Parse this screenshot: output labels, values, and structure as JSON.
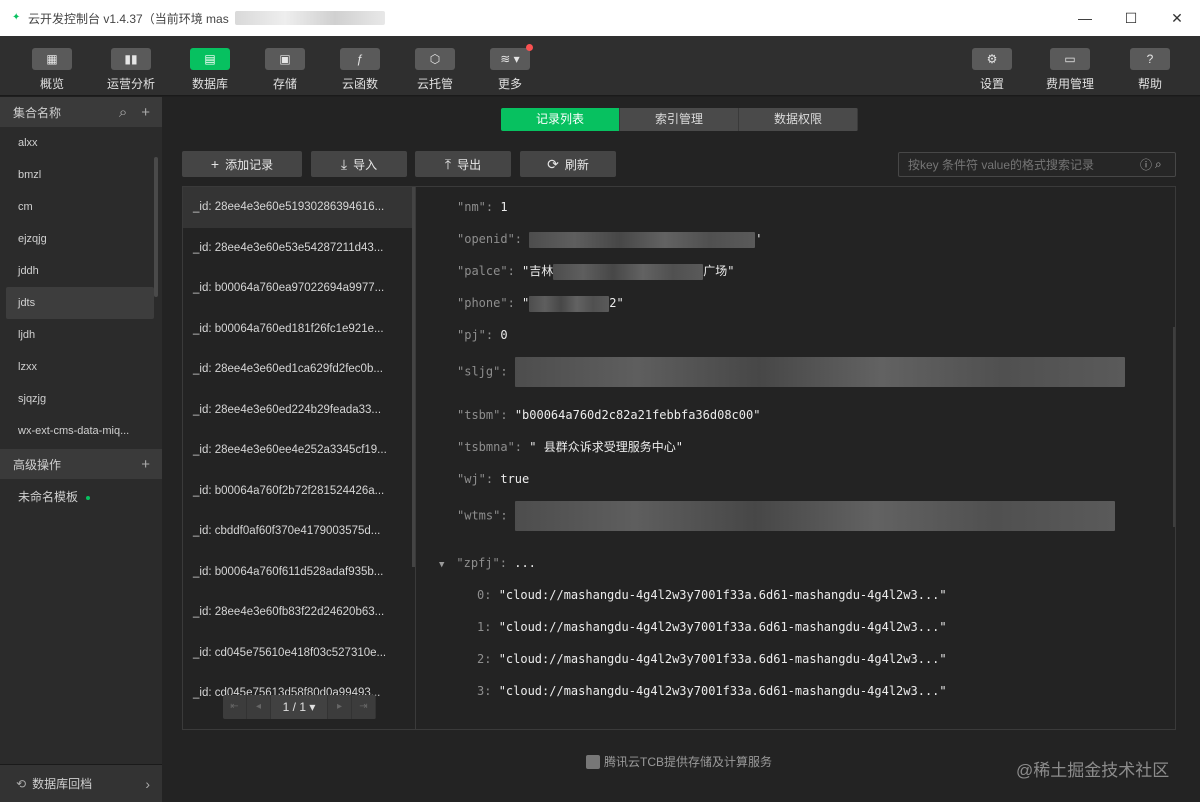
{
  "window": {
    "title": "云开发控制台 v1.4.37（当前环境 mas",
    "controls": [
      "minimize",
      "maximize",
      "close"
    ]
  },
  "toolbar": {
    "left": [
      {
        "label": "概览",
        "icon": "grid-icon"
      },
      {
        "label": "运营分析",
        "icon": "bar-chart-icon"
      },
      {
        "label": "数据库",
        "icon": "database-icon",
        "active": true
      },
      {
        "label": "存储",
        "icon": "save-icon"
      },
      {
        "label": "云函数",
        "icon": "function-icon"
      },
      {
        "label": "云托管",
        "icon": "box-icon"
      },
      {
        "label": "更多",
        "icon": "layers-icon",
        "badge": true
      }
    ],
    "right": [
      {
        "label": "设置",
        "icon": "gear-icon"
      },
      {
        "label": "费用管理",
        "icon": "billing-icon"
      },
      {
        "label": "帮助",
        "icon": "help-icon"
      }
    ]
  },
  "sidebar": {
    "collections_header": "集合名称",
    "collections": [
      "alxx",
      "bmzl",
      "cm",
      "ejzqjg",
      "jddh",
      "jdts",
      "ljdh",
      "lzxx",
      "sjqzjg",
      "wx-ext-cms-data-miq..."
    ],
    "selected_collection": "jdts",
    "advanced_header": "高级操作",
    "templates": [
      "未命名模板"
    ],
    "footer": "数据库回档"
  },
  "tabs": [
    "记录列表",
    "索引管理",
    "数据权限"
  ],
  "active_tab": "记录列表",
  "actions": {
    "add": "添加记录",
    "import": "导入",
    "export": "导出",
    "refresh": "刷新"
  },
  "search": {
    "placeholder": "按key 条件符 value的格式搜索记录"
  },
  "records": [
    "_id: 28ee4e3e60e51930286394616...",
    "_id: 28ee4e3e60e53e54287211d43...",
    "_id: b00064a760ea97022694a9977...",
    "_id: b00064a760ed181f26fc1e921e...",
    "_id: 28ee4e3e60ed1ca629fd2fec0b...",
    "_id: 28ee4e3e60ed224b29feada33...",
    "_id: 28ee4e3e60ee4e252a3345cf19...",
    "_id: b00064a760f2b72f281524426a...",
    "_id: cbddf0af60f370e4179003575d...",
    "_id: b00064a760f611d528adaf935b...",
    "_id: 28ee4e3e60fb83f22d24620b63...",
    "_id: cd045e75610e418f03c527310e...",
    "_id: cd045e75613d58f80d0a99493..."
  ],
  "pager": {
    "text": "1 / 1"
  },
  "detail": {
    "nm": {
      "key": "\"nm\":",
      "value": "1"
    },
    "openid": {
      "key": "\"openid\":",
      "value_end": "'"
    },
    "palce": {
      "key": "\"palce\":",
      "value_start": "\"吉林",
      "value_end": "广场\""
    },
    "phone": {
      "key": "\"phone\":",
      "value_start": "\"",
      "value_end": "2\""
    },
    "pj": {
      "key": "\"pj\":",
      "value": "0"
    },
    "sljg": {
      "key": "\"sljg\":"
    },
    "tsbm": {
      "key": "\"tsbm\":",
      "value": "\"b00064a760d2c82a21febbfa36d08c00\""
    },
    "tsbmna": {
      "key": "\"tsbmna\":",
      "value": "\" 县群众诉求受理服务中心\""
    },
    "wj": {
      "key": "\"wj\":",
      "value": "true"
    },
    "wtms": {
      "key": "\"wtms\":"
    },
    "zpfj": {
      "key": "\"zpfj\":",
      "value": "..."
    },
    "zpfj_items": [
      {
        "index": "0:",
        "value": "\"cloud://mashangdu-4g4l2w3y7001f33a.6d61-mashangdu-4g4l2w3...\""
      },
      {
        "index": "1:",
        "value": "\"cloud://mashangdu-4g4l2w3y7001f33a.6d61-mashangdu-4g4l2w3...\""
      },
      {
        "index": "2:",
        "value": "\"cloud://mashangdu-4g4l2w3y7001f33a.6d61-mashangdu-4g4l2w3...\""
      },
      {
        "index": "3:",
        "value": "\"cloud://mashangdu-4g4l2w3y7001f33a.6d61-mashangdu-4g4l2w3...\""
      }
    ]
  },
  "footer_note": "腾讯云TCB提供存储及计算服务",
  "watermark": "@稀土掘金技术社区",
  "colors": {
    "accent": "#07c160",
    "badge": "#fa5151"
  }
}
